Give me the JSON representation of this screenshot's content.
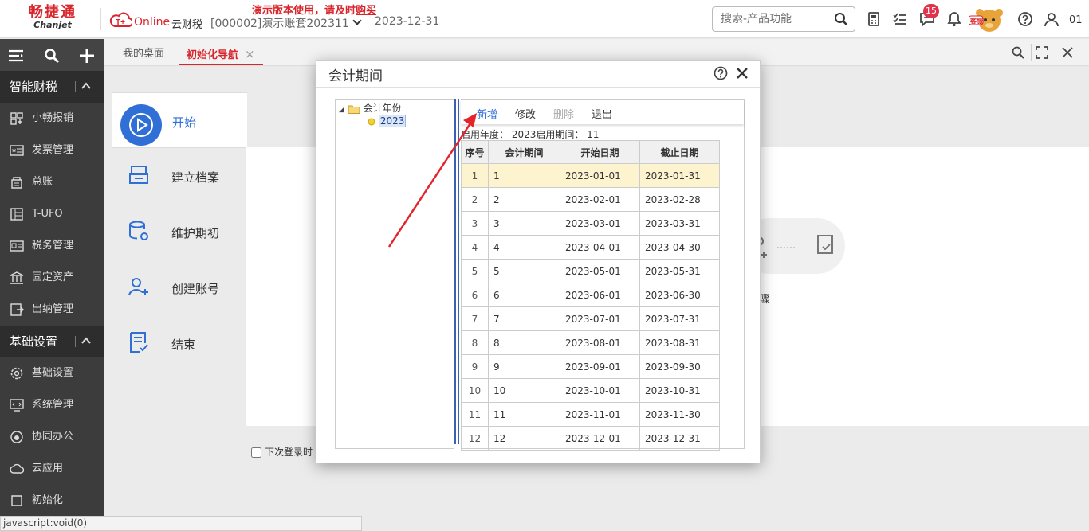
{
  "topbar": {
    "logo_cn": "畅捷通",
    "logo_en": "Chanjet",
    "product_online": "Online",
    "product_name": "云财税",
    "account": "[000002]演示账套202311",
    "date": "2023-12-31",
    "notice_prefix": "演示版本使用，请及时",
    "notice_link": "购买",
    "search_placeholder": "搜索-产品功能",
    "message_badge": "15",
    "mascot_text": "客服",
    "user": "01"
  },
  "sidebar": {
    "sections": [
      {
        "title": "智能财税",
        "items": [
          "小畅报销",
          "发票管理",
          "总账",
          "T-UFO",
          "税务管理",
          "固定资产",
          "出纳管理"
        ]
      },
      {
        "title": "基础设置",
        "items": [
          "基础设置",
          "系统管理",
          "协同办公",
          "云应用",
          "初始化"
        ]
      }
    ]
  },
  "tabs": [
    {
      "label": "我的桌面"
    },
    {
      "label": "初始化导航"
    }
  ],
  "wizard": {
    "items": [
      "开始",
      "建立档案",
      "维护期初",
      "创建账号",
      "结束"
    ],
    "bg_step_label": "骤",
    "next_login_label": "下次登录时"
  },
  "dialog": {
    "title": "会计期间",
    "tree_root": "会计年份",
    "tree_child": "2023",
    "toolbar": {
      "add": "新增",
      "edit": "修改",
      "delete": "删除",
      "exit": "退出"
    },
    "info": "启用年度： 2023启用期间： 11",
    "columns": [
      "序号",
      "会计期间",
      "开始日期",
      "截止日期"
    ],
    "rows": [
      [
        "1",
        "1",
        "2023-01-01",
        "2023-01-31"
      ],
      [
        "2",
        "2",
        "2023-02-01",
        "2023-02-28"
      ],
      [
        "3",
        "3",
        "2023-03-01",
        "2023-03-31"
      ],
      [
        "4",
        "4",
        "2023-04-01",
        "2023-04-30"
      ],
      [
        "5",
        "5",
        "2023-05-01",
        "2023-05-31"
      ],
      [
        "6",
        "6",
        "2023-06-01",
        "2023-06-30"
      ],
      [
        "7",
        "7",
        "2023-07-01",
        "2023-07-31"
      ],
      [
        "8",
        "8",
        "2023-08-01",
        "2023-08-31"
      ],
      [
        "9",
        "9",
        "2023-09-01",
        "2023-09-30"
      ],
      [
        "10",
        "10",
        "2023-10-01",
        "2023-10-31"
      ],
      [
        "11",
        "11",
        "2023-11-01",
        "2023-11-30"
      ],
      [
        "12",
        "12",
        "2023-12-01",
        "2023-12-31"
      ]
    ]
  },
  "statusbar": {
    "text": "javascript:void(0)"
  },
  "colors": {
    "brand_red": "#d8262c",
    "link_blue": "#2f6fd6",
    "sidebar_bg": "#3c3c3c",
    "selected_row": "#fdf4cf"
  }
}
